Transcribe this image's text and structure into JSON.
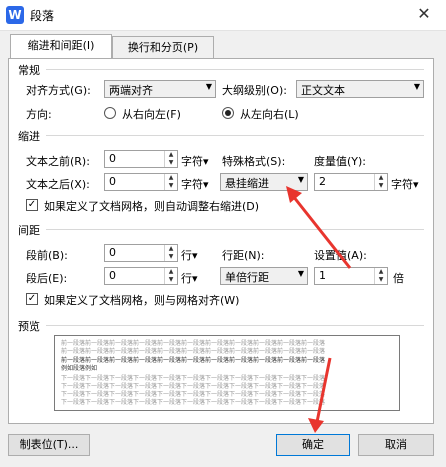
{
  "window": {
    "title": "段落",
    "app_icon": "W",
    "close_label": "✕"
  },
  "tabs": [
    {
      "label": "缩进和间距(I)",
      "active": true
    },
    {
      "label": "换行和分页(P)",
      "active": false
    }
  ],
  "general": {
    "header": "常规",
    "align_label": "对齐方式(G):",
    "align_value": "两端对齐",
    "outline_label": "大纲级别(O):",
    "outline_value": "正文文本",
    "direction_label": "方向:",
    "rtl_label": "从右向左(F)",
    "ltr_label": "从左向右(L)",
    "selected_direction": "ltr"
  },
  "indent": {
    "header": "缩进",
    "before_label": "文本之前(R):",
    "before_value": "0",
    "before_unit": "字符▾",
    "after_label": "文本之后(X):",
    "after_value": "0",
    "after_unit": "字符▾",
    "special_label": "特殊格式(S):",
    "special_value": "悬挂缩进",
    "measure_label": "度量值(Y):",
    "measure_value": "2",
    "measure_unit": "字符▾",
    "auto_adjust_label": "如果定义了文档网格，则自动调整右缩进(D)",
    "auto_adjust_checked": true
  },
  "spacing": {
    "header": "间距",
    "before_label": "段前(B):",
    "before_value": "0",
    "before_unit": "行▾",
    "after_label": "段后(E):",
    "after_value": "0",
    "after_unit": "行▾",
    "line_label": "行距(N):",
    "line_value": "单倍行距",
    "setting_label": "设置值(A):",
    "setting_value": "1",
    "setting_unit": "倍",
    "grid_align_label": "如果定义了文档网格，则与网格对齐(W)",
    "grid_align_checked": true
  },
  "preview": {
    "header": "预览",
    "prev_line": "前一段落前一段落前一段落前一段落前一段落前一段落前一段落前一段落前一段落前一段落前一段落",
    "sample_line": "例如段落例如",
    "next_line": "下一段落下一段落下一段落下一段落下一段落下一段落下一段落下一段落下一段落下一段落下一段落"
  },
  "buttons": {
    "tabs_label": "制表位(T)...",
    "ok_label": "确定",
    "cancel_label": "取消"
  },
  "colors": {
    "accent": "#0078d7",
    "arrow": "#e8352e",
    "icon": "#2b68e8"
  }
}
